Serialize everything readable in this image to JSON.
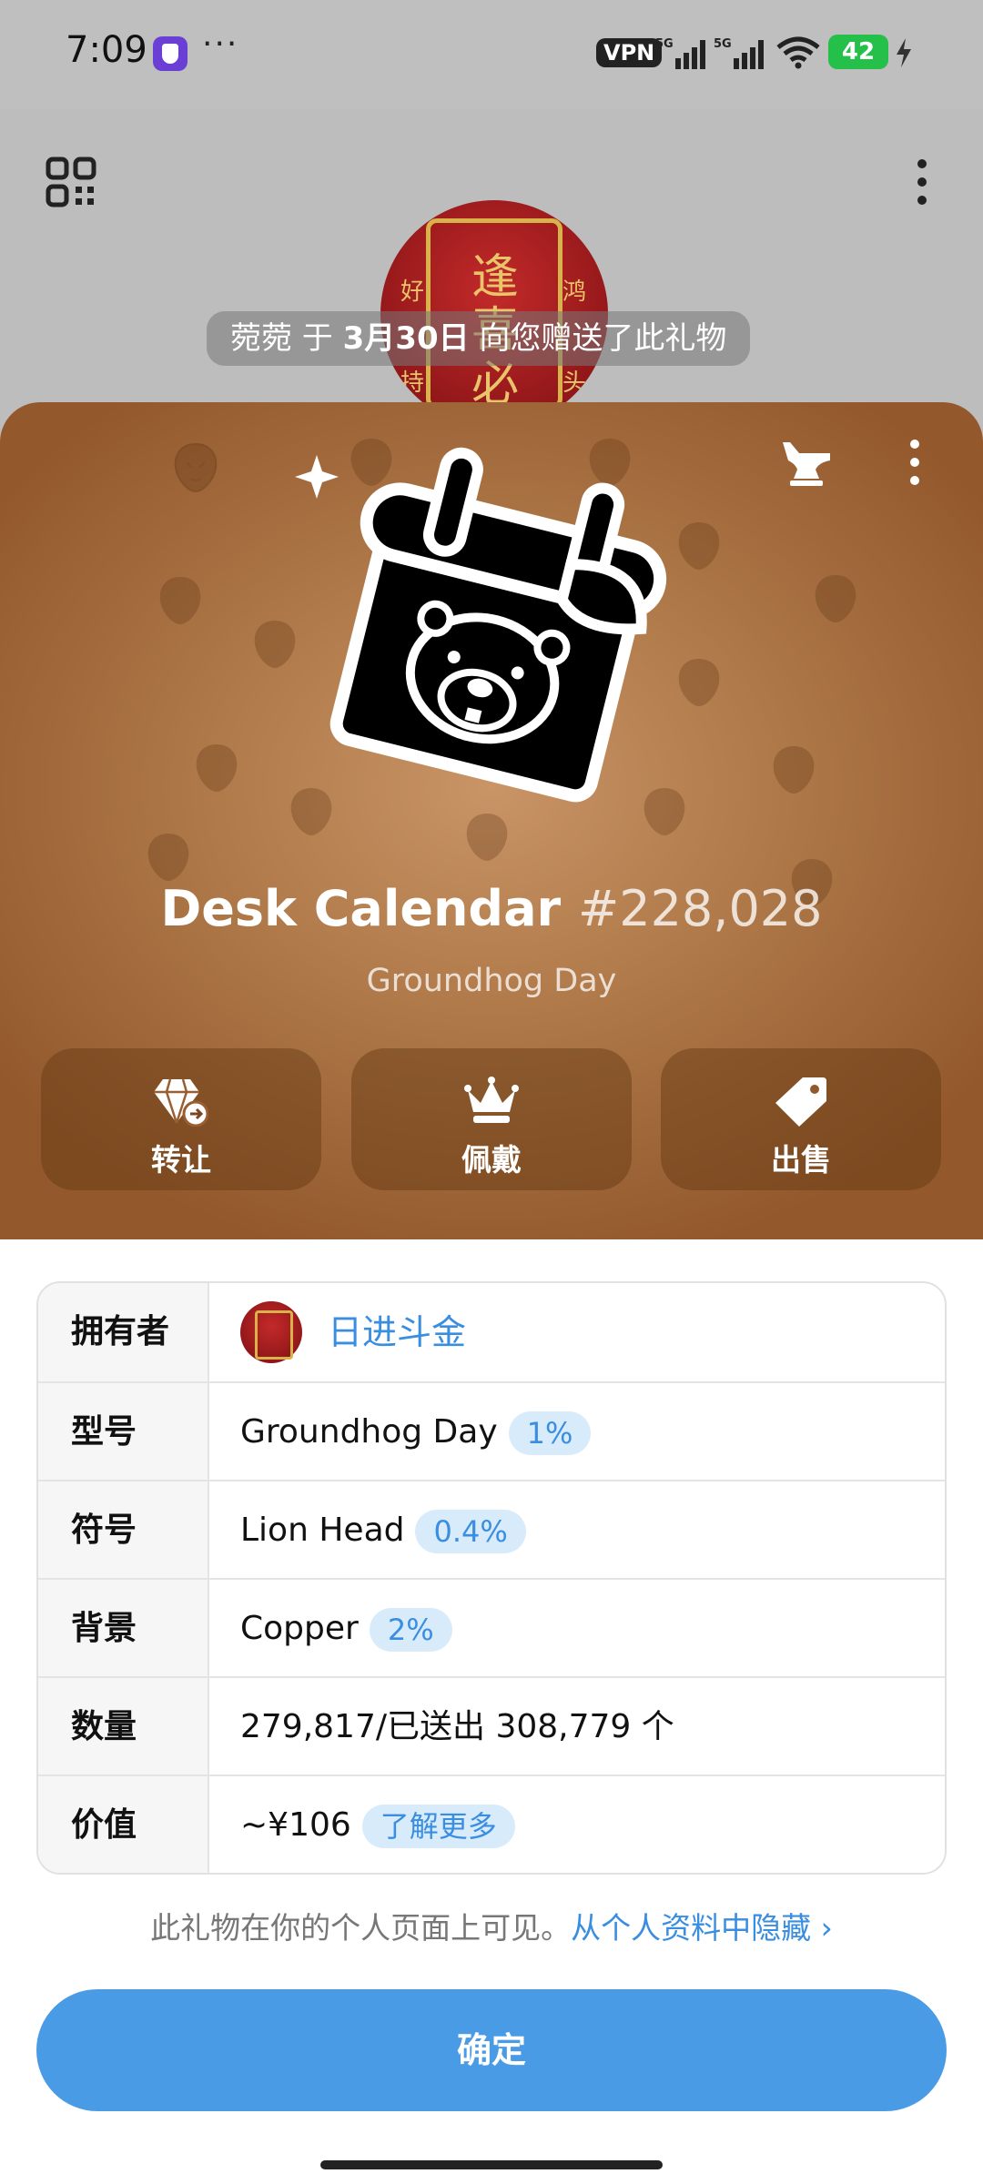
{
  "status_bar": {
    "time": "7:09",
    "more": "···",
    "vpn": "VPN",
    "battery": "42",
    "net1": "5G",
    "net2": "5G"
  },
  "header": {
    "sender_name": "菀菀",
    "sender_mid1": " 于 ",
    "sender_date": "3月30日",
    "sender_mid2": " 向您赠送了此礼物"
  },
  "gift": {
    "name": "Desk Calendar",
    "number": "#228,028",
    "model": "Groundhog Day",
    "actions": [
      {
        "label": "转让",
        "icon": "diamond-transfer-icon"
      },
      {
        "label": "佩戴",
        "icon": "crown-icon"
      },
      {
        "label": "出售",
        "icon": "price-tag-icon"
      }
    ],
    "background_colors": [
      "#c99466",
      "#93592d"
    ]
  },
  "info": {
    "owner_label": "拥有者",
    "owner_name": "日进斗金",
    "model_label": "型号",
    "model_value": "Groundhog Day",
    "model_pct": "1%",
    "symbol_label": "符号",
    "symbol_value": "Lion Head",
    "symbol_pct": "0.4%",
    "bg_label": "背景",
    "bg_value": "Copper",
    "bg_pct": "2%",
    "qty_label": "数量",
    "qty_value": "279,817/已送出 308,779 个",
    "value_label": "价值",
    "value_value": "~¥106",
    "learn_more": "了解更多"
  },
  "footer": {
    "note": "此礼物在你的个人页面上可见。",
    "hide_link": "从个人资料中隐藏 ›",
    "ok_button": "确定"
  },
  "avatar_glyphs": {
    "top": "逢",
    "mid": "喜",
    "bottom": "必",
    "left_top": "好",
    "right_top": "鸿",
    "left_bottom": "持",
    "right_bottom": "头"
  },
  "colors": {
    "accent": "#4a9be6",
    "link": "#3a8ee0",
    "badge_bg": "#d8ebfb"
  }
}
